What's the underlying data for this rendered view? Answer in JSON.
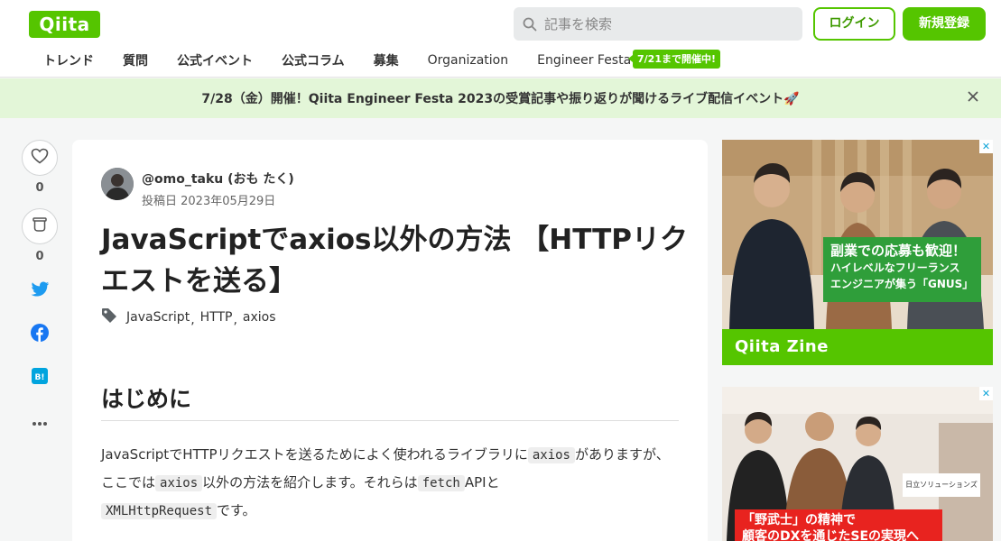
{
  "header": {
    "logo": "Qiita",
    "search_placeholder": "記事を検索",
    "login_label": "ログイン",
    "signup_label": "新規登録",
    "nav": [
      "トレンド",
      "質問",
      "公式イベント",
      "公式コラム",
      "募集",
      "Organization",
      "Engineer Festa"
    ],
    "festa_badge": "7/21まで開催中!"
  },
  "banner": {
    "text": "7/28（金）開催！Qiita Engineer Festa 2023の受賞記事や振り返りが聞けるライブ配信イベント🚀",
    "close_icon": "close-icon"
  },
  "side": {
    "like_count": "0",
    "stock_count": "0"
  },
  "article": {
    "author": "@omo_taku (おも たく)",
    "posted": "投稿日 2023年05月29日",
    "title": "JavaScriptでaxios以外の方法 【HTTPリクエストを送る】",
    "tags": [
      "JavaScript",
      "HTTP",
      "axios"
    ],
    "heading": "はじめに",
    "para": {
      "t1": "JavaScriptでHTTPリクエストを送るためによく使われるライブラリに",
      "c1": "axios",
      "t2": "がありますが、ここでは",
      "c2": "axios",
      "t3": "以外の方法を紹介します。それらは",
      "c3": "fetch",
      "t4": "APIと",
      "c4": "XMLHttpRequest",
      "t5": "です。"
    }
  },
  "ads": {
    "ad1": {
      "line1": "副業での応募も歓迎！",
      "line2": "ハイレベルなフリーランス",
      "line3": "エンジニアが集う「GNUS」",
      "brand": "Qiita Zine"
    },
    "ad2": {
      "sign": "日立ソリューションズ",
      "line1": "「野武士」の精神で",
      "line2": "顧客のDXを通じたSEの実現へ"
    }
  },
  "colors": {
    "brand": "#55c500",
    "banner_bg": "#e3f6d8"
  }
}
